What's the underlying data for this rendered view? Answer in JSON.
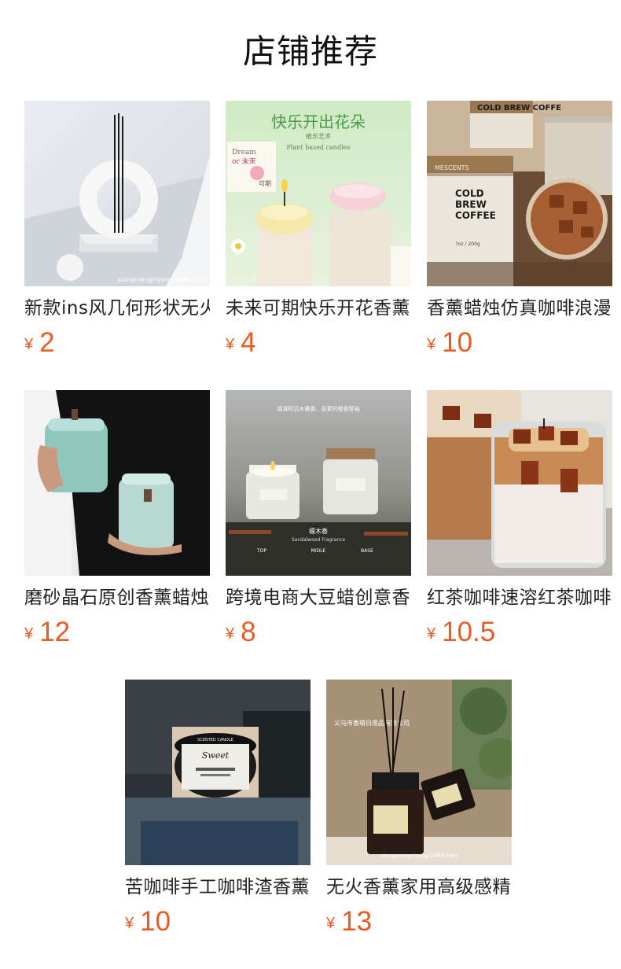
{
  "page": {
    "title": "店铺推荐"
  },
  "colors": {
    "price": "#ea5a23",
    "title": "#111111",
    "text": "#222222",
    "background": "#ffffff"
  },
  "products": [
    {
      "name": "新款ins风几何形状无火香薰",
      "currency": "¥",
      "price": "2"
    },
    {
      "name": "未来可期快乐开花香薰蜡烛",
      "currency": "¥",
      "price": "4"
    },
    {
      "name": "香薰蜡烛仿真咖啡浪漫氛围",
      "currency": "¥",
      "price": "10"
    },
    {
      "name": "磨砂晶石原创香薰蜡烛伴手礼",
      "currency": "¥",
      "price": "12"
    },
    {
      "name": "跨境电商大豆蜡创意香薰蜡烛",
      "currency": "¥",
      "price": "8"
    },
    {
      "name": "红茶咖啡速溶红茶咖啡蜡烛",
      "currency": "¥",
      "price": "10.5"
    },
    {
      "name": "苦咖啡手工咖啡渣香薰蜡烛",
      "currency": "¥",
      "price": "10"
    },
    {
      "name": "无火香薰家用高级感精油",
      "currency": "¥",
      "price": "13"
    }
  ],
  "image_texts": {
    "p2_headline": "快乐开出花朵",
    "p2_sub": "植乐艺术",
    "p2_sub2": "Plant based candles",
    "p2_box1": "Dream",
    "p2_box2": "or 未来",
    "p2_box3": "可期",
    "p3_label1": "COLD",
    "p3_label2": "BREW",
    "p3_label3": "COFFEE",
    "p3_brand": "MESCENTS",
    "p3_weight": "7oz / 200g",
    "p3_topjar": "COLD BREW COFFE",
    "p5_top": "阅读时沉木雅香，品茗时橙香莹袖",
    "p5_name": "檀木香",
    "p5_name_en": "Sandalwood Fragrance",
    "p5_top_note": "TOP",
    "p5_mid_note": "MIDLE",
    "p5_base_note": "BASE",
    "p7_brand": "Sweet",
    "p7_line": "SCENTED CANDLE",
    "p8_watermark": "义乌市香萌日用品有限公司",
    "p8_site": "xiongmengriyong.1688.com",
    "p1_site": "xiongmengriyong.1688.com"
  }
}
